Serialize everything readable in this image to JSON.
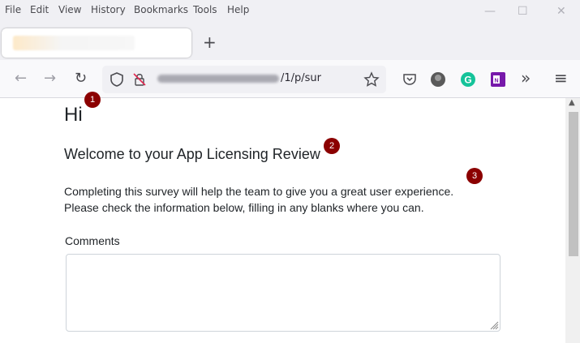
{
  "menu": [
    "File",
    "Edit",
    "View",
    "History",
    "Bookmarks",
    "Tools",
    "Help"
  ],
  "window_controls": {
    "minimize": "—",
    "maximize": "☐",
    "close": "✕"
  },
  "tabbar": {
    "new_tab": "+"
  },
  "navbar": {
    "back": "←",
    "forward": "→",
    "reload": "↻",
    "url_visible": "/1/p/sur",
    "overflow": "»",
    "menu": "≡"
  },
  "icons": {
    "shield": "shield-icon",
    "lock": "lock-slash-icon",
    "star": "star-icon",
    "pocket": "pocket-icon",
    "profile": "avatar-icon",
    "grammarly": "grammarly-icon",
    "onenote": "onenote-icon"
  },
  "colors": {
    "badge": "#8b0000",
    "grammarly": "#15c39a",
    "onenote": "#7719aa"
  },
  "page": {
    "heading": "Hi",
    "subheading": "Welcome to your App Licensing Review",
    "intro_line1": "Completing this survey will help the team to give you a great user experience.",
    "intro_line2": "Please check the information below, filling in any blanks where you can.",
    "comments_label": "Comments",
    "comments_value": ""
  },
  "badges": [
    "1",
    "2",
    "3"
  ]
}
